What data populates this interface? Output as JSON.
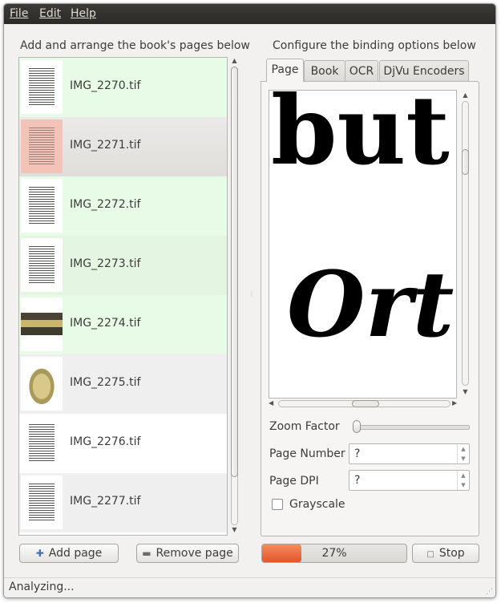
{
  "menu": {
    "file": "File",
    "edit": "Edit",
    "help": "Help"
  },
  "left": {
    "heading": "Add and arrange the book's pages below",
    "pages": [
      {
        "name": "IMG_2270.tif",
        "bg": "#e8fbe6",
        "thumb": "text"
      },
      {
        "name": "IMG_2271.tif",
        "bg": "#e6e5e3",
        "thumb": "pink",
        "selected": true
      },
      {
        "name": "IMG_2272.tif",
        "bg": "#e8fbe6",
        "thumb": "text"
      },
      {
        "name": "IMG_2273.tif",
        "bg": "#e4f6e2",
        "thumb": "text"
      },
      {
        "name": "IMG_2274.tif",
        "bg": "#e8fbe6",
        "thumb": "photo1"
      },
      {
        "name": "IMG_2275.tif",
        "bg": "#efefef",
        "thumb": "photo2"
      },
      {
        "name": "IMG_2276.tif",
        "bg": "#ffffff",
        "thumb": "text"
      },
      {
        "name": "IMG_2277.tif",
        "bg": "#efefef",
        "thumb": "text"
      }
    ],
    "add_button": "Add page",
    "remove_button": "Remove page"
  },
  "right": {
    "heading": "Configure the binding options below",
    "tabs": [
      "Page",
      "Book",
      "OCR",
      "DjVu Encoders"
    ],
    "active_tab": "Page",
    "preview_text": {
      "line1": "but",
      "line2": "Ort"
    },
    "zoom_label": "Zoom Factor",
    "zoom_value": 0.0,
    "page_number_label": "Page Number",
    "page_number_value": "?",
    "page_dpi_label": "Page DPI",
    "page_dpi_value": "?",
    "grayscale_label": "Grayscale",
    "grayscale_checked": false
  },
  "progress": {
    "percent": 27,
    "text": "27%"
  },
  "stop_button": "Stop",
  "status": "Analyzing...",
  "colors": {
    "menubar": "#3c3b37",
    "progress": "#e2562a",
    "list_green": "#e8fbe6"
  }
}
